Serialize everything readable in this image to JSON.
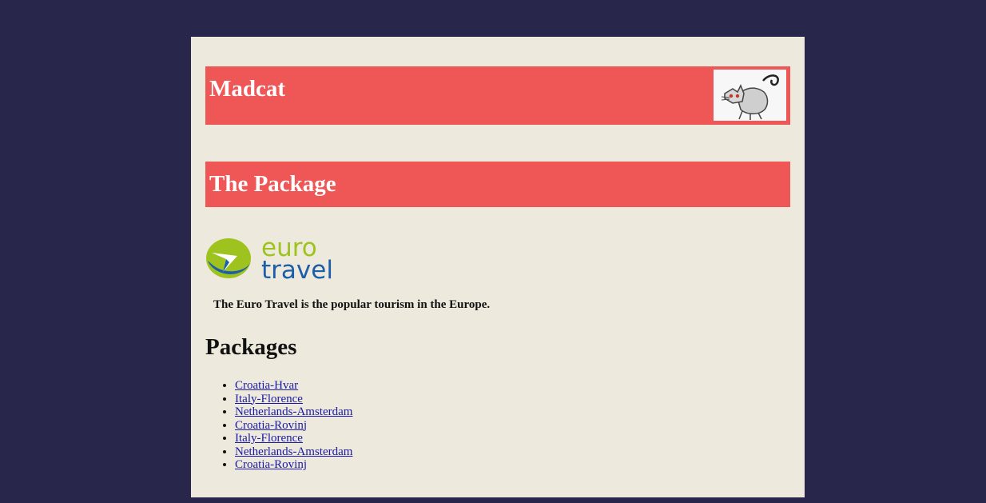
{
  "header": {
    "title": "Madcat",
    "logo_icon": "cat-icon"
  },
  "section": {
    "title": "The Package"
  },
  "brand_logo": {
    "line1": "euro",
    "line2": "travel",
    "icon": "eurotravel-swoosh-icon",
    "colors": {
      "green": "#9ec31e",
      "blue": "#1d5ea8"
    }
  },
  "intro": {
    "text": "The Euro Travel is the popular tourism in the Europe."
  },
  "packages": {
    "heading": "Packages",
    "items": [
      {
        "label": "Croatia-Hvar"
      },
      {
        "label": "Italy-Florence"
      },
      {
        "label": "Netherlands-Amsterdam"
      },
      {
        "label": "Croatia-Rovinj"
      },
      {
        "label": "Italy-Florence"
      },
      {
        "label": "Netherlands-Amsterdam"
      },
      {
        "label": "Croatia-Rovinj"
      }
    ]
  },
  "colors": {
    "background": "#28264a",
    "page": "#ede9dd",
    "accent": "#ef5757",
    "link": "#1a1aa6"
  }
}
